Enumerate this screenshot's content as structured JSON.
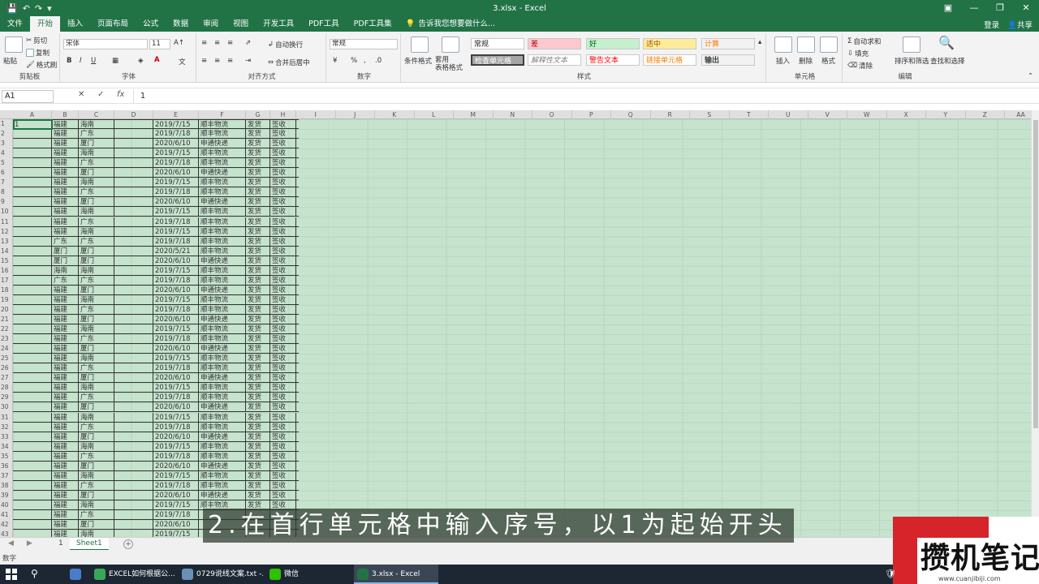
{
  "titlebar": {
    "title": "3.xlsx - Excel",
    "qat": [
      "save-icon",
      "undo-icon",
      "redo-icon"
    ],
    "win": [
      "▣",
      "—",
      "❐",
      "✕"
    ]
  },
  "tabs": [
    "文件",
    "开始",
    "插入",
    "页面布局",
    "公式",
    "数据",
    "审阅",
    "视图",
    "开发工具",
    "PDF工具",
    "PDF工具集"
  ],
  "tell_me": "告诉我您想要做什么...",
  "account": {
    "login": "登录",
    "share": "共享"
  },
  "ribbon": {
    "clipboard": {
      "label": "剪贴板",
      "paste": "粘贴",
      "cut": "剪切",
      "copy": "复制",
      "format": "格式刷"
    },
    "font": {
      "label": "字体",
      "name": "宋体",
      "size": "11",
      "bold": "B",
      "italic": "I",
      "underline": "U"
    },
    "align": {
      "label": "对齐方式",
      "wrap": "自动换行",
      "merge": "合并后居中"
    },
    "number": {
      "label": "数字",
      "format": "常规",
      "percent": "%"
    },
    "styles": {
      "label": "样式",
      "cond": "条件格式",
      "table": "套用\n表格格式",
      "cells": [
        "常规",
        "差",
        "好",
        "适中",
        "计算",
        "检查单元格",
        "解释性文本",
        "警告文本",
        "链接单元格",
        "输出"
      ]
    },
    "cells_grp": {
      "label": "单元格",
      "insert": "插入",
      "delete": "删除",
      "format": "格式"
    },
    "edit": {
      "label": "编辑",
      "autosum": "自动求和",
      "fill": "填充",
      "clear": "清除",
      "sort": "排序和筛选",
      "find": "查找和选择"
    }
  },
  "formula": {
    "namebox": "A1",
    "cancel": "✕",
    "enter": "✓",
    "fx": "fx",
    "value": "1"
  },
  "columns": [
    "A",
    "B",
    "C",
    "D",
    "E",
    "F",
    "G",
    "H",
    "I",
    "J",
    "K",
    "L",
    "M",
    "N",
    "O",
    "P",
    "Q",
    "R",
    "S",
    "T",
    "U",
    "V",
    "W",
    "X",
    "Y",
    "Z",
    "AA"
  ],
  "rows": [
    [
      "1",
      "福建",
      "海南",
      "",
      "2019/7/15",
      "顺丰物流",
      "发货",
      "签收"
    ],
    [
      "",
      "福建",
      "广东",
      "",
      "2019/7/18",
      "顺丰物流",
      "发货",
      "签收"
    ],
    [
      "",
      "福建",
      "厦门",
      "",
      "2020/6/10",
      "申通快递",
      "发货",
      "签收"
    ],
    [
      "",
      "福建",
      "海南",
      "",
      "2019/7/15",
      "顺丰物流",
      "发货",
      "签收"
    ],
    [
      "",
      "福建",
      "广东",
      "",
      "2019/7/18",
      "顺丰物流",
      "发货",
      "签收"
    ],
    [
      "",
      "福建",
      "厦门",
      "",
      "2020/6/10",
      "申通快递",
      "发货",
      "签收"
    ],
    [
      "",
      "福建",
      "海南",
      "",
      "2019/7/15",
      "顺丰物流",
      "发货",
      "签收"
    ],
    [
      "",
      "福建",
      "广东",
      "",
      "2019/7/18",
      "顺丰物流",
      "发货",
      "签收"
    ],
    [
      "",
      "福建",
      "厦门",
      "",
      "2020/6/10",
      "申通快递",
      "发货",
      "签收"
    ],
    [
      "",
      "福建",
      "海南",
      "",
      "2019/7/15",
      "顺丰物流",
      "发货",
      "签收"
    ],
    [
      "",
      "福建",
      "广东",
      "",
      "2019/7/18",
      "顺丰物流",
      "发货",
      "签收"
    ],
    [
      "",
      "福建",
      "海南",
      "",
      "2019/7/15",
      "顺丰物流",
      "发货",
      "签收"
    ],
    [
      "",
      "广东",
      "广东",
      "",
      "2019/7/18",
      "顺丰物流",
      "发货",
      "签收"
    ],
    [
      "",
      "厦门",
      "厦门",
      "",
      "2020/5/21",
      "顺丰物流",
      "发货",
      "签收"
    ],
    [
      "",
      "厦门",
      "厦门",
      "",
      "2020/6/10",
      "申通快递",
      "发货",
      "签收"
    ],
    [
      "",
      "海南",
      "海南",
      "",
      "2019/7/15",
      "顺丰物流",
      "发货",
      "签收"
    ],
    [
      "",
      "广东",
      "广东",
      "",
      "2019/7/18",
      "顺丰物流",
      "发货",
      "签收"
    ],
    [
      "",
      "福建",
      "厦门",
      "",
      "2020/6/10",
      "申通快递",
      "发货",
      "签收"
    ],
    [
      "",
      "福建",
      "海南",
      "",
      "2019/7/15",
      "顺丰物流",
      "发货",
      "签收"
    ],
    [
      "",
      "福建",
      "广东",
      "",
      "2019/7/18",
      "顺丰物流",
      "发货",
      "签收"
    ],
    [
      "",
      "福建",
      "厦门",
      "",
      "2020/6/10",
      "申通快递",
      "发货",
      "签收"
    ],
    [
      "",
      "福建",
      "海南",
      "",
      "2019/7/15",
      "顺丰物流",
      "发货",
      "签收"
    ],
    [
      "",
      "福建",
      "广东",
      "",
      "2019/7/18",
      "顺丰物流",
      "发货",
      "签收"
    ],
    [
      "",
      "福建",
      "厦门",
      "",
      "2020/6/10",
      "申通快递",
      "发货",
      "签收"
    ],
    [
      "",
      "福建",
      "海南",
      "",
      "2019/7/15",
      "顺丰物流",
      "发货",
      "签收"
    ],
    [
      "",
      "福建",
      "广东",
      "",
      "2019/7/18",
      "顺丰物流",
      "发货",
      "签收"
    ],
    [
      "",
      "福建",
      "厦门",
      "",
      "2020/6/10",
      "申通快递",
      "发货",
      "签收"
    ],
    [
      "",
      "福建",
      "海南",
      "",
      "2019/7/15",
      "顺丰物流",
      "发货",
      "签收"
    ],
    [
      "",
      "福建",
      "广东",
      "",
      "2019/7/18",
      "顺丰物流",
      "发货",
      "签收"
    ],
    [
      "",
      "福建",
      "厦门",
      "",
      "2020/6/10",
      "申通快递",
      "发货",
      "签收"
    ],
    [
      "",
      "福建",
      "海南",
      "",
      "2019/7/15",
      "顺丰物流",
      "发货",
      "签收"
    ],
    [
      "",
      "福建",
      "广东",
      "",
      "2019/7/18",
      "顺丰物流",
      "发货",
      "签收"
    ],
    [
      "",
      "福建",
      "厦门",
      "",
      "2020/6/10",
      "申通快递",
      "发货",
      "签收"
    ],
    [
      "",
      "福建",
      "海南",
      "",
      "2019/7/15",
      "顺丰物流",
      "发货",
      "签收"
    ],
    [
      "",
      "福建",
      "广东",
      "",
      "2019/7/18",
      "顺丰物流",
      "发货",
      "签收"
    ],
    [
      "",
      "福建",
      "厦门",
      "",
      "2020/6/10",
      "申通快递",
      "发货",
      "签收"
    ],
    [
      "",
      "福建",
      "海南",
      "",
      "2019/7/15",
      "顺丰物流",
      "发货",
      "签收"
    ],
    [
      "",
      "福建",
      "广东",
      "",
      "2019/7/18",
      "顺丰物流",
      "发货",
      "签收"
    ],
    [
      "",
      "福建",
      "厦门",
      "",
      "2020/6/10",
      "申通快递",
      "发货",
      "签收"
    ],
    [
      "",
      "福建",
      "海南",
      "",
      "2019/7/15",
      "顺丰物流",
      "发货",
      "签收"
    ],
    [
      "",
      "福建",
      "广东",
      "",
      "2019/7/18",
      "",
      "",
      ""
    ],
    [
      "",
      "福建",
      "厦门",
      "",
      "2020/6/10",
      "",
      "",
      ""
    ],
    [
      "",
      "福建",
      "海南",
      "",
      "2019/7/15",
      "",
      "",
      ""
    ]
  ],
  "sheettabs": {
    "count": "1",
    "active": "Sheet1",
    "add": "+"
  },
  "status": {
    "ready": "数字"
  },
  "subtitle": "2.在首行单元格中输入序号，以1为起始开头",
  "logo": {
    "text": "攒机笔记",
    "url": "www.cuanjibiji.com"
  },
  "taskbar": [
    {
      "label": "EXCEL如何根据公...",
      "color": "#3aa757"
    },
    {
      "label": "0729说线文案.txt -...",
      "color": "#6b8fb5"
    },
    {
      "label": "微信",
      "color": "#2dc100"
    },
    {
      "label": "3.xlsx - Excel",
      "color": "#217346"
    }
  ],
  "colors": {
    "brand": "#217346",
    "sheet_bg": "#c5e3cd",
    "logo_red": "#d6242a"
  }
}
